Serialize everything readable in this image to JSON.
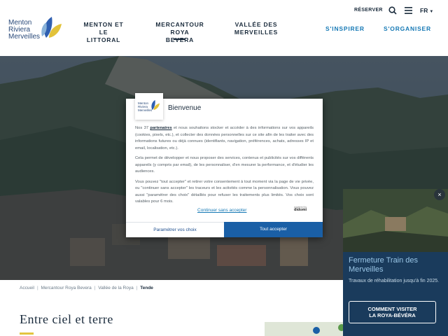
{
  "header": {
    "logo": {
      "line1": "Menton",
      "line2": "Riviera",
      "line3": "Merveilles"
    },
    "nav": [
      {
        "line1": "MENTON ET",
        "line2": "LE LITTORAL"
      },
      {
        "line1": "MERCANTOUR",
        "line2": "ROYA BEVERA",
        "active": true
      },
      {
        "line1": "VALLÉE DES",
        "line2": "MERVEILLES"
      }
    ],
    "reserver": "RÉSERVER",
    "language": "FR",
    "cta_inspirer": "S'INSPIRER",
    "cta_organiser": "S'ORGANISER"
  },
  "breadcrumb": [
    "Accueil",
    "Mercantour Roya Bevera",
    "Vallée de la Roya",
    "Tende"
  ],
  "page_title": "Entre ciel et terre",
  "promo": {
    "title": "Fermeture Train des Merveilles",
    "description": "Travaux de réhabilitation jusqu'à fin 2025.",
    "button_line1": "COMMENT VISITER",
    "button_line2": "LA ROYA-BÉVÉRA",
    "close": "×"
  },
  "map": {
    "zoom_in": "+"
  },
  "consent": {
    "title": "Bienvenue",
    "p1_before": "Nos 37 ",
    "p1_link": "partenaires",
    "p1_after": " et nous souhaitons stocker et accéder à des informations sur vos appareils (cookies, pixels, etc.), et collecter des données personnelles sur ce site afin de les traiter avec des informations futures ou déjà connues (identifiants, navigation, préférences, achats, adresses IP et email, localisation, etc.).",
    "p2": "Cela permet de développer et nous proposer des services, contenus et publicités sur vos différents appareils (y compris par email), de les personnaliser, d'en mesurer la performance, et d'étudier les audiences.",
    "p3": "Vous pouvez \"tout accepter\" et retirer votre consentement à tout moment via la page de vie privée, ou \"continuer sans accepter\" les traceurs et les activités comme la personnalisation. Vous pouvez aussi \"paramétrer des choix\" détaillés pour refuser les traitements plus limités. Vos choix sont valables pour 6 mois.",
    "continue_without": "Continuer sans accepter",
    "powered_by": "powered by",
    "brand": "didomi",
    "settings_button": "Paramétrer vos choix",
    "accept_button": "Tout accepter"
  },
  "colors": {
    "accent_blue": "#1679b5",
    "accept_blue": "#1a5fa6",
    "promo_bg": "#1a3b5c",
    "title_accent": "#e3c540"
  }
}
